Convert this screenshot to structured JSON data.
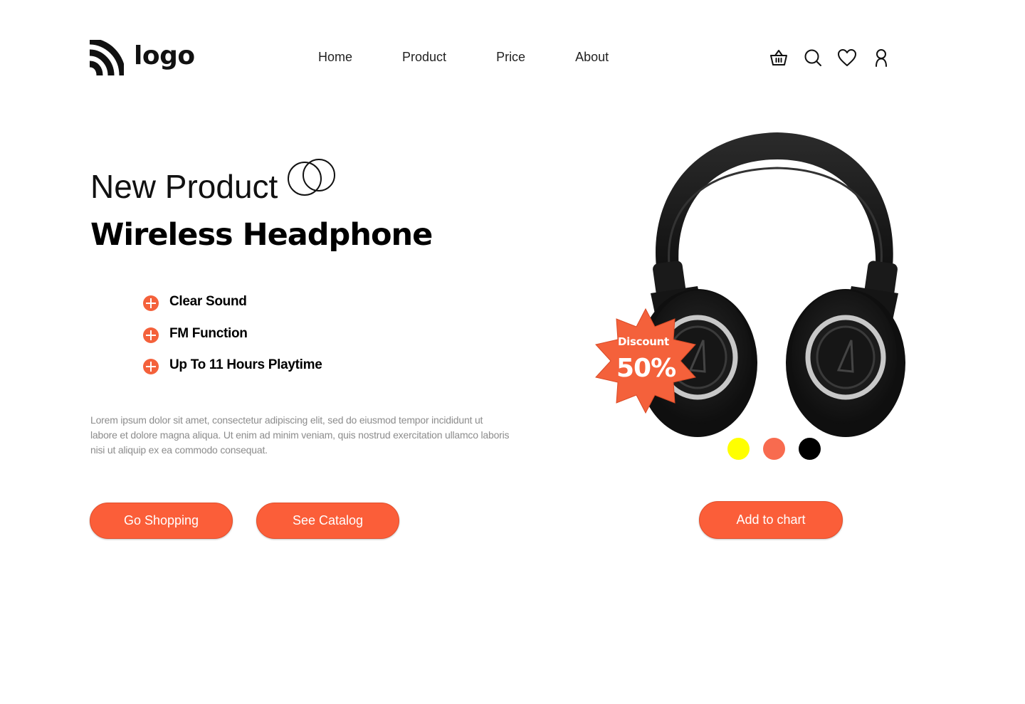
{
  "header": {
    "logo_text": "logo",
    "nav": [
      "Home",
      "Product",
      "Price",
      "About"
    ],
    "icons": [
      "basket-icon",
      "search-icon",
      "heart-icon",
      "user-icon"
    ]
  },
  "hero": {
    "subtitle": "New Product",
    "title": "Wireless Headphone",
    "features": [
      "Clear Sound",
      "FM Function",
      "Up To 11 Hours Playtime"
    ],
    "description": "Lorem ipsum dolor sit amet, consectetur adipiscing elit, sed do eiusmod tempor incididunt ut labore et dolore magna aliqua. Ut enim ad minim veniam, quis nostrud exercitation ullamco laboris nisi ut aliquip ex ea commodo consequat.",
    "buttons": {
      "go_shopping": "Go Shopping",
      "see_catalog": "See Catalog"
    }
  },
  "product": {
    "badge_label": "Discount",
    "badge_value": "50%",
    "colors": [
      "#ffff00",
      "#f86b4f",
      "#000000"
    ],
    "add_button": "Add to chart"
  },
  "theme": {
    "accent": "#fb5e39"
  }
}
